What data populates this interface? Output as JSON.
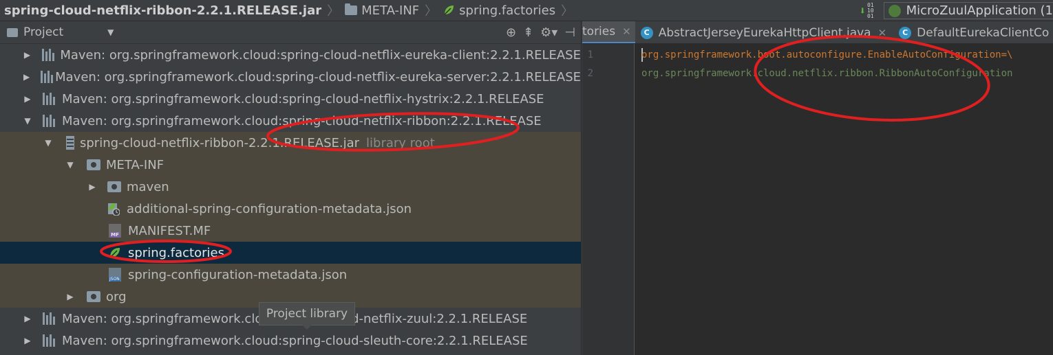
{
  "navbar": {
    "crumbs": [
      "spring-cloud-netflix-ribbon-2.2.1.RELEASE.jar",
      "META-INF",
      "spring.factories"
    ],
    "run_config": "MicroZuulApplication (1"
  },
  "project_panel": {
    "title": "Project",
    "tree": [
      {
        "label": "Maven: org.springframework.cloud:spring-cloud-netflix-eureka-client:2.2.1.RELEASE"
      },
      {
        "label": "Maven: org.springframework.cloud:spring-cloud-netflix-eureka-server:2.2.1.RELEASE"
      },
      {
        "label": "Maven: org.springframework.cloud:spring-cloud-netflix-hystrix:2.2.1.RELEASE"
      },
      {
        "label": "Maven: org.springframework.cloud:spring-cloud-netflix-ribbon:2.2.1.RELEASE"
      },
      {
        "label": "spring-cloud-netflix-ribbon-2.2.1.RELEASE.jar",
        "hint": "library root"
      },
      {
        "label": "META-INF"
      },
      {
        "label": "maven"
      },
      {
        "label": "additional-spring-configuration-metadata.json"
      },
      {
        "label": "MANIFEST.MF"
      },
      {
        "label": "spring.factories"
      },
      {
        "label": "spring-configuration-metadata.json"
      },
      {
        "label": "org"
      },
      {
        "label": "Maven: org.springframework.cloud:spring-cloud-netflix-zuul:2.2.1.RELEASE"
      },
      {
        "label": "Maven: org.springframework.cloud:spring-cloud-sleuth-core:2.2.1.RELEASE"
      }
    ],
    "tooltip": "Project library"
  },
  "editor": {
    "tabs": [
      {
        "label": "tories"
      },
      {
        "label": "AbstractJerseyEurekaHttpClient.java"
      },
      {
        "label": "DefaultEurekaClientCo"
      }
    ],
    "lines": [
      {
        "number": "1",
        "text": "org.springframework.boot.autoconfigure.EnableAutoConfiguration=\\"
      },
      {
        "number": "2",
        "text": "org.springframework.cloud.netflix.ribbon.RibbonAutoConfiguration"
      }
    ]
  },
  "colors": {
    "annotation": "#e02020",
    "selection": "#0d293e",
    "library_bg": "#4b473c",
    "spring_leaf": "#6db33f"
  }
}
